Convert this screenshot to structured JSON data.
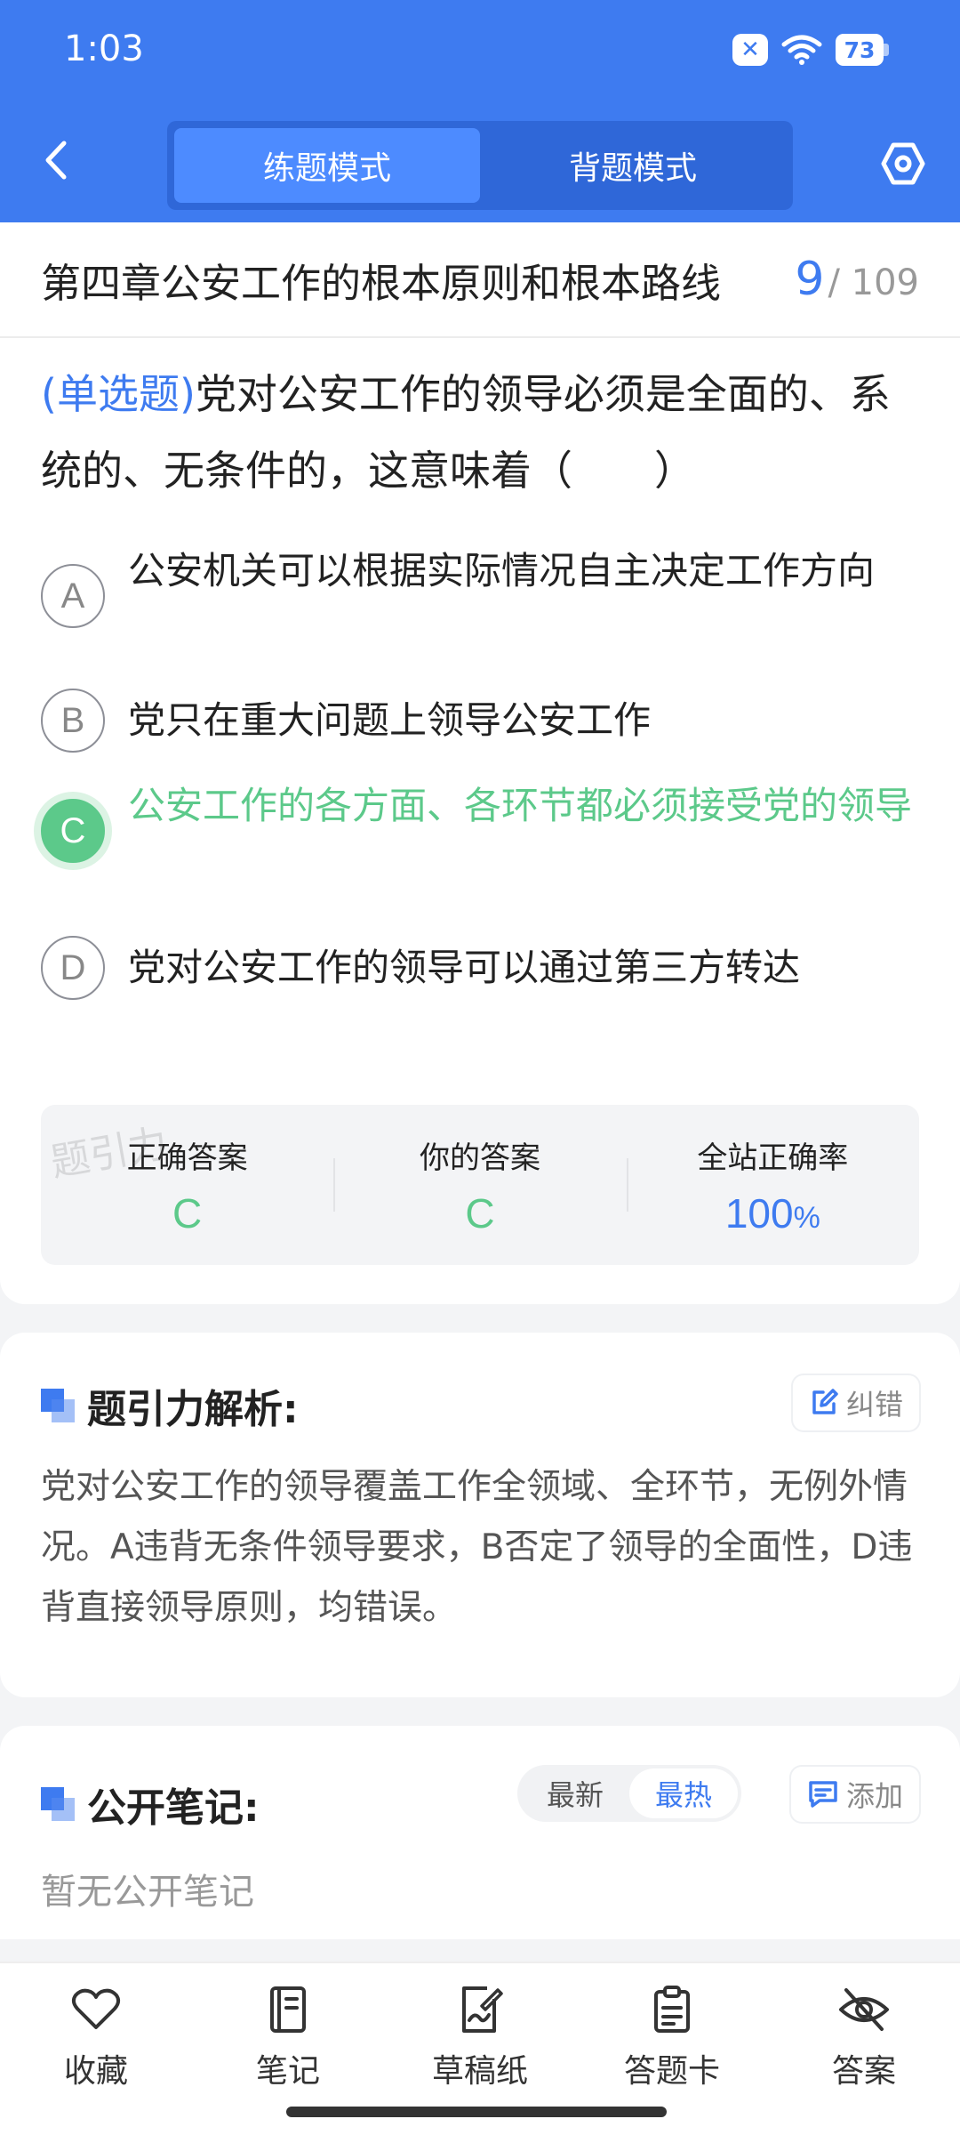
{
  "status_bar": {
    "time": "1:03",
    "notif_icon": "x-icon",
    "battery": "73"
  },
  "header": {
    "tabs": [
      {
        "label": "练题模式",
        "active": true
      },
      {
        "label": "背题模式",
        "active": false
      }
    ]
  },
  "chapter": {
    "title": "第四章公安工作的根本原则和根本路线",
    "current": "9",
    "total": "/ 109"
  },
  "question": {
    "type": "(单选题)",
    "text": "党对公安工作的领导必须是全面的、系统的、无条件的，这意味着（　　）"
  },
  "options": [
    {
      "letter": "A",
      "text": "公安机关可以根据实际情况自主决定工作方向",
      "correct": false
    },
    {
      "letter": "B",
      "text": "党只在重大问题上领导公安工作",
      "correct": false
    },
    {
      "letter": "C",
      "text": "公安工作的各方面、各环节都必须接受党的领导",
      "correct": true
    },
    {
      "letter": "D",
      "text": "党对公安工作的领导可以通过第三方转达",
      "correct": false
    }
  ],
  "answer_stats": {
    "correct_label": "正确答案",
    "correct_value": "C",
    "yours_label": "你的答案",
    "yours_value": "C",
    "rate_label": "全站正确率",
    "rate_value": "100",
    "rate_unit": "%",
    "watermark": "题引力"
  },
  "analysis": {
    "title": "题引力解析:",
    "report_label": "纠错",
    "text": "党对公安工作的领导覆盖工作全领域、全环节，无例外情况。A违背无条件领导要求，B否定了领导的全面性，D违背直接领导原则，均错误。"
  },
  "notes": {
    "title": "公开笔记:",
    "sort_new": "最新",
    "sort_hot": "最热",
    "add_label": "添加",
    "empty": "暂无公开笔记"
  },
  "toolbar": [
    {
      "label": "收藏",
      "icon": "heart-icon"
    },
    {
      "label": "笔记",
      "icon": "notebook-icon"
    },
    {
      "label": "草稿纸",
      "icon": "draft-icon"
    },
    {
      "label": "答题卡",
      "icon": "clipboard-icon"
    },
    {
      "label": "答案",
      "icon": "eye-off-icon"
    }
  ],
  "colors": {
    "primary": "#3e7bf0",
    "correct": "#5cc98a"
  }
}
